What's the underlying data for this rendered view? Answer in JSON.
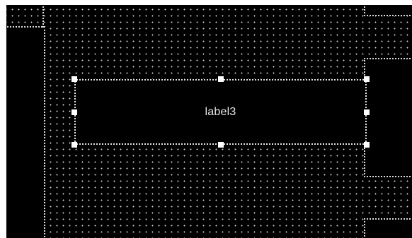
{
  "designer": {
    "selected_control": {
      "text": "label3"
    },
    "grid": {
      "enabled": true,
      "dot_color": "#cfcfcf"
    },
    "colors": {
      "background": "#000000",
      "outline": "#dcdcdc",
      "handle": "#ffffff",
      "text": "#e8e8e8"
    }
  }
}
